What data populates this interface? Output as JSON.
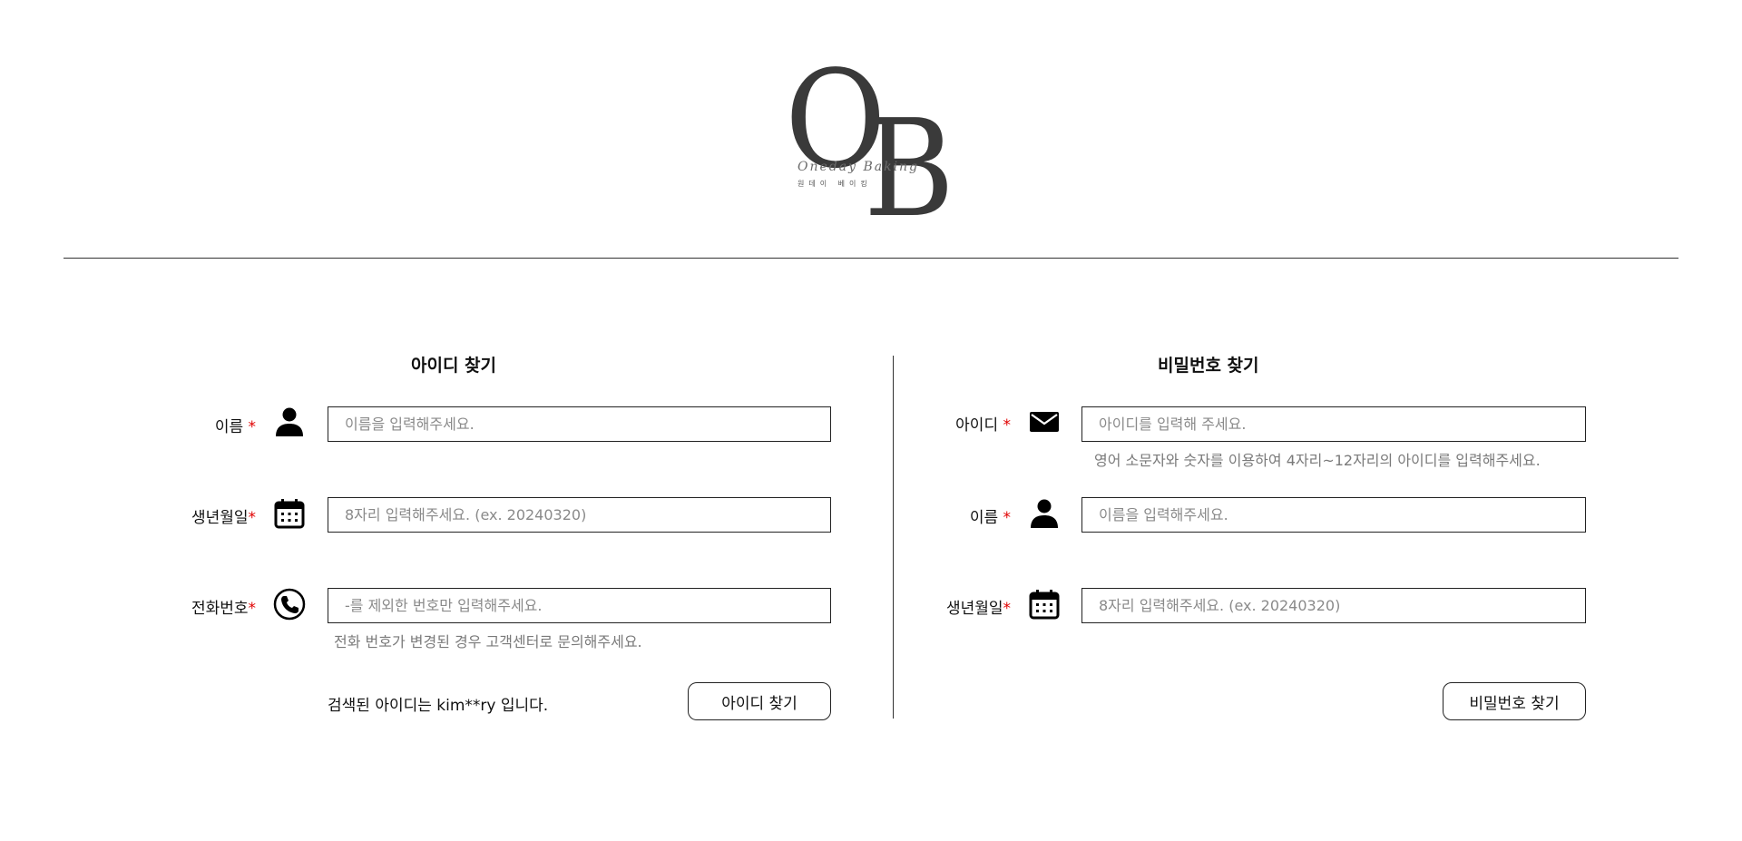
{
  "logo": {
    "letter_o": "O",
    "letter_b": "B",
    "script_text": "Oneday Baking",
    "hangul_text": "원데이 베이킹"
  },
  "find_id": {
    "title": "아이디 찾기",
    "fields": [
      {
        "label": "이름",
        "required_mark": "*",
        "icon": "person-icon",
        "placeholder": "이름을 입력해주세요.",
        "value": ""
      },
      {
        "label": "생년월일",
        "required_mark": "*",
        "icon": "calendar-icon",
        "placeholder": "8자리 입력해주세요. (ex. 20240320)",
        "value": ""
      },
      {
        "label": "전화번호",
        "required_mark": "*",
        "icon": "phone-icon",
        "placeholder": "-를 제외한 번호만 입력해주세요.",
        "value": ""
      }
    ],
    "phone_hint": "전화 번호가 변경된 경우 고객센터로 문의해주세요.",
    "result_text": "검색된 아이디는 kim**ry 입니다.",
    "button_label": "아이디 찾기"
  },
  "find_password": {
    "title": "비밀번호 찾기",
    "fields": [
      {
        "label": "아이디",
        "required_mark": "*",
        "icon": "envelope-icon",
        "placeholder": "아이디를 입력해 주세요.",
        "value": ""
      },
      {
        "label": "이름",
        "required_mark": "*",
        "icon": "person-icon",
        "placeholder": "이름을 입력해주세요.",
        "value": ""
      },
      {
        "label": "생년월일",
        "required_mark": "*",
        "icon": "calendar-icon",
        "placeholder": "8자리 입력해주세요. (ex. 20240320)",
        "value": ""
      }
    ],
    "id_hint": "영어 소문자와 숫자를 이용하여 4자리~12자리의 아이디를 입력해주세요.",
    "button_label": "비밀번호 찾기"
  },
  "colors": {
    "required": "#e00000",
    "border": "#222222",
    "placeholder": "#8a8a8a",
    "logo": "#3a3a3a"
  }
}
